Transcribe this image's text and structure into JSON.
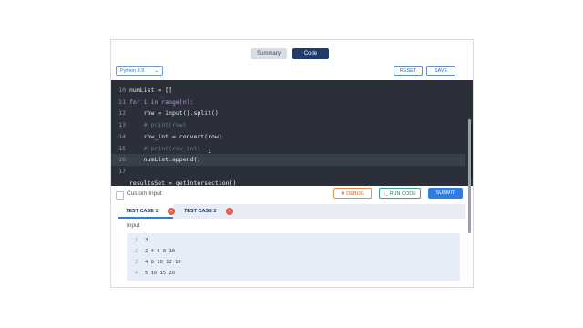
{
  "tabs": {
    "summary": "Summary",
    "code": "Code"
  },
  "toolbar": {
    "language": "Python 3.9",
    "reset": "RESET",
    "save": "SAVE"
  },
  "editor": {
    "lines": [
      {
        "num": "10",
        "code": "numList = []"
      },
      {
        "num": "11",
        "code": "for i in range(n):"
      },
      {
        "num": "12",
        "code": "    row = input().split()"
      },
      {
        "num": "13",
        "code": "    # print(row)"
      },
      {
        "num": "14",
        "code": "    row_int = convert(row)"
      },
      {
        "num": "15",
        "code": "    # print(row_int)"
      },
      {
        "num": "16",
        "code": "    numList.append()"
      },
      {
        "num": "17",
        "code": ""
      },
      {
        "num": "",
        "code": "resultsSet = getIntersection()"
      }
    ]
  },
  "actions": {
    "custom_input": "Custom Input",
    "debug": "DEBUG",
    "run_code": "RUN CODE",
    "submit": "SUBMIT"
  },
  "testcases": {
    "tab1": "TEST CASE 1",
    "tab2": "TEST CASE 2"
  },
  "input": {
    "label": "Input",
    "lines": [
      {
        "num": "1",
        "text": "3"
      },
      {
        "num": "2",
        "text": "2 4 6 8 10"
      },
      {
        "num": "3",
        "text": "4 8 10 12 16"
      },
      {
        "num": "4",
        "text": "5 10 15 20"
      }
    ]
  },
  "colors": {
    "accent": "#2f7de0",
    "editor_bg": "#2b2f3a",
    "code_tab": "#1f3a6b"
  }
}
